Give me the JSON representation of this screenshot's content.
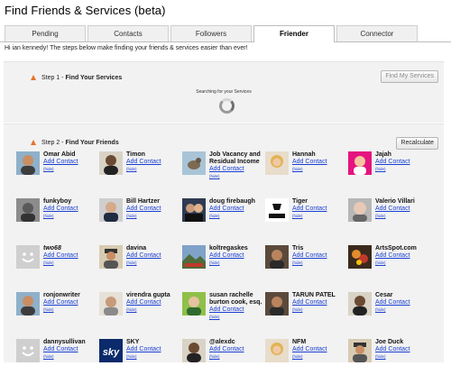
{
  "page": {
    "title": "Find Friends & Services (beta)",
    "intro": "Hi ian kennedy! The steps below make finding your friends & services easier than ever!"
  },
  "tabs": [
    {
      "label": "Pending",
      "active": false
    },
    {
      "label": "Contacts",
      "active": false
    },
    {
      "label": "Followers",
      "active": false
    },
    {
      "label": "Friender",
      "active": true
    },
    {
      "label": "Connector",
      "active": false
    }
  ],
  "step1": {
    "prefix": "Step 1 - ",
    "title": "Find Your Services",
    "button": "Find My Services",
    "searching": "Searching for your Services"
  },
  "step2": {
    "prefix": "Step 2 - ",
    "title": "Find Your Friends",
    "button": "Recalculate",
    "add_label": "Add Contact",
    "hide_label": "(hide)"
  },
  "friends": [
    {
      "name": "Omar Abid",
      "avatar": "person-tan"
    },
    {
      "name": "Timon",
      "avatar": "person-dark"
    },
    {
      "name": "Job Vacancy and Residual Income",
      "avatar": "bird"
    },
    {
      "name": "Hannah",
      "avatar": "person-blonde"
    },
    {
      "name": "Jajah",
      "avatar": "person-magenta"
    },
    {
      "name": "funkyboy",
      "avatar": "person-gray"
    },
    {
      "name": "Bill Hartzer",
      "avatar": "person-suit"
    },
    {
      "name": "doug firebaugh",
      "avatar": "couple"
    },
    {
      "name": "Tiger",
      "avatar": "logo-tiger"
    },
    {
      "name": "Valerio Villari",
      "avatar": "person-pale"
    },
    {
      "name": "two68",
      "avatar": "default"
    },
    {
      "name": "davina",
      "avatar": "person-hat"
    },
    {
      "name": "koltregaskes",
      "avatar": "landscape"
    },
    {
      "name": "Tris",
      "avatar": "person-brown"
    },
    {
      "name": "ArtsSpot.com",
      "avatar": "art"
    },
    {
      "name": "ronjonwriter",
      "avatar": "person-tan"
    },
    {
      "name": "virendra gupta",
      "avatar": "person-light"
    },
    {
      "name": "susan rachelle burton cook, esq.",
      "avatar": "person-green"
    },
    {
      "name": "TARUN PATEL",
      "avatar": "person-brown"
    },
    {
      "name": "Cesar",
      "avatar": "person-dark"
    },
    {
      "name": "dannysullivan",
      "avatar": "default"
    },
    {
      "name": "SKY",
      "avatar": "logo-sky"
    },
    {
      "name": "@alexdc",
      "avatar": "person-dark"
    },
    {
      "name": "NFM",
      "avatar": "person-blonde"
    },
    {
      "name": "Joe Duck",
      "avatar": "person-hat"
    }
  ],
  "colors": {
    "link": "#1a3fd1",
    "warning": "#e8722a",
    "panel_bg": "#f2f2f2"
  }
}
